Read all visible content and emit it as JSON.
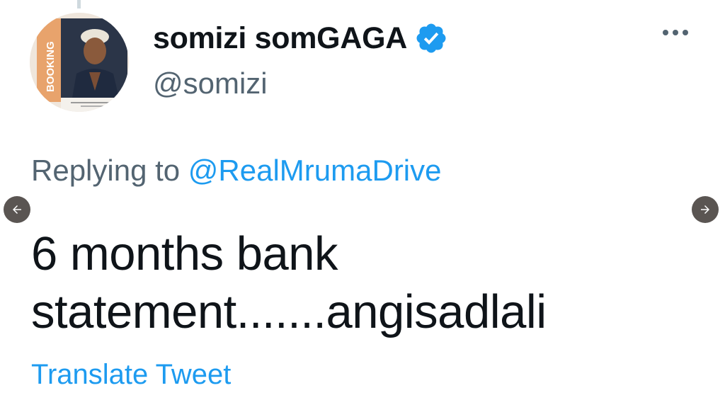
{
  "tweet": {
    "author": {
      "display_name": "somizi somGAGA",
      "handle": "@somizi",
      "verified": true,
      "avatar_text": "BOOKING"
    },
    "replying_prefix": "Replying to",
    "replying_to": "@RealMrumaDrive",
    "text_lines": [
      "6 months bank",
      "statement.......angisadlali"
    ],
    "translate_label": "Translate Tweet"
  },
  "icons": {
    "more": "more-horizontal-icon",
    "verified": "verified-badge-icon",
    "prev": "arrow-left-icon",
    "next": "arrow-right-icon"
  },
  "colors": {
    "text_primary": "#0f1419",
    "text_secondary": "#536471",
    "link": "#1d9bf0",
    "nav_button": "#5a5552"
  }
}
